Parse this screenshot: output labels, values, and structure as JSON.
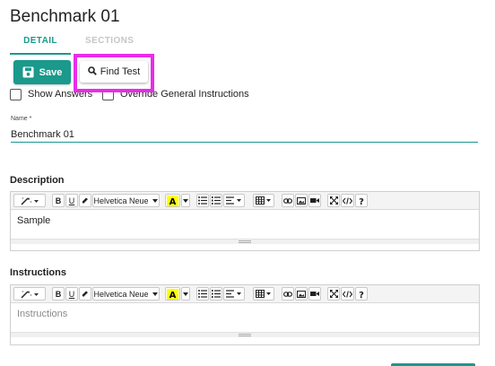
{
  "page": {
    "title": "Benchmark 01"
  },
  "tabs": [
    {
      "label": "DETAIL",
      "active": true
    },
    {
      "label": "SECTIONS",
      "active": false
    }
  ],
  "toolbar": {
    "save_label": "Save",
    "find_test_label": "Find Test"
  },
  "options": {
    "show_answers_label": "Show Answers",
    "override_label": "Override General Instructions"
  },
  "name_field": {
    "label": "Name *",
    "value": "Benchmark 01"
  },
  "description": {
    "heading": "Description",
    "font_name": "Helvetica Neue",
    "content": "Sample"
  },
  "instructions": {
    "heading": "Instructions",
    "font_name": "Helvetica Neue",
    "placeholder": "Instructions"
  },
  "colors": {
    "accent": "#1a998c",
    "highlight": "#ea2bea",
    "text_color_swatch": "#ffff00"
  }
}
